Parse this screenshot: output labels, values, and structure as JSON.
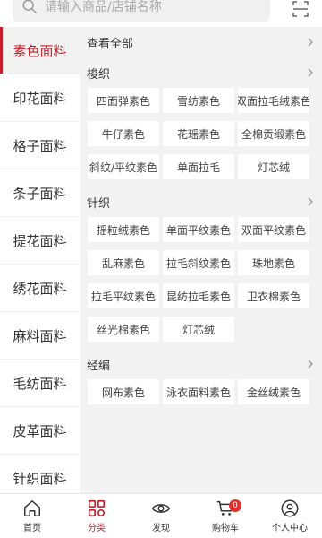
{
  "search": {
    "placeholder": "请输入商品/店铺名称"
  },
  "sidebar": {
    "items": [
      {
        "label": "素色面料"
      },
      {
        "label": "印花面料"
      },
      {
        "label": "格子面料"
      },
      {
        "label": "条子面料"
      },
      {
        "label": "提花面料"
      },
      {
        "label": "绣花面料"
      },
      {
        "label": "麻料面料"
      },
      {
        "label": "毛纺面料"
      },
      {
        "label": "皮革面料"
      },
      {
        "label": "针织面料"
      }
    ]
  },
  "content": {
    "view_all": "查看全部",
    "sections": [
      {
        "title": "梭织",
        "chips": [
          "四面弹素色",
          "雪纺素色",
          "双面拉毛绒素色",
          "牛仔素色",
          "花瑶素色",
          "全棉贡缎素色",
          "斜纹/平纹素色",
          "单面拉毛",
          "灯芯绒"
        ]
      },
      {
        "title": "针织",
        "chips": [
          "摇粒绒素色",
          "单面平纹素色",
          "双面平纹素色",
          "乱麻素色",
          "拉毛斜纹素色",
          "珠地素色",
          "拉毛平纹素色",
          "昆纺拉毛素色",
          "卫衣棉素色",
          "丝光棉素色",
          "灯芯绒"
        ]
      },
      {
        "title": "经编",
        "chips": [
          "网布素色",
          "泳衣面料素色",
          "金丝绒素色"
        ]
      }
    ]
  },
  "bottom_nav": {
    "home": "首页",
    "category": "分类",
    "discover": "发现",
    "cart": "购物车",
    "cart_badge": "0",
    "profile": "个人中心"
  },
  "colors": {
    "accent": "#c81e2a",
    "badge": "#e0322b",
    "panel_bg": "#f2f2f2"
  }
}
